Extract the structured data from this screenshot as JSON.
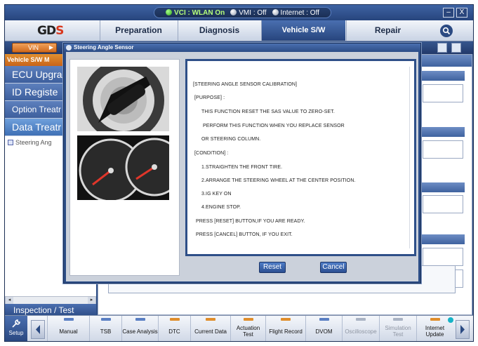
{
  "status_bar": {
    "vci_label": "VCI : WLAN On",
    "vmi_label": "VMI : Off",
    "internet_label": "Internet : Off",
    "minimize_label": "‒",
    "close_label": "X"
  },
  "logo": {
    "text": "GD",
    "mark": "S"
  },
  "nav": {
    "tabs": [
      {
        "label": "Preparation"
      },
      {
        "label": "Diagnosis"
      },
      {
        "label": "Vehicle S/W Management"
      },
      {
        "label": "Repair"
      }
    ]
  },
  "sub_bar": {
    "vin_label": "VIN",
    "vin_arrow": "▶"
  },
  "sidebar": {
    "header": "Vehicle S/W M",
    "items": [
      {
        "label": "ECU Upgra"
      },
      {
        "label": "ID Registe"
      },
      {
        "label": "Option Treatr"
      },
      {
        "label": "Data Treatr"
      }
    ],
    "tree_item": "Steering Ang",
    "inspection_tab": "Inspection / Test"
  },
  "dialog": {
    "title": "Steering Angle Sensor",
    "lines": [
      "[STEERING ANGLE SENSOR CALIBRATION]",
      "[PURPOSE] :",
      "THIS FUNCTION RESET THE SAS VALUE TO ZERO-SET.",
      "PERFORM THIS FUNCTION WHEN YOU REPLACE SENSOR",
      "OR STEERING COLUMN.",
      "[CONDITION] :",
      "1.STRAIGHTEN THE FRONT TIRE.",
      "2.ARRANGE THE STEERING WHEEL AT THE CENTER POSITION.",
      "3.IG KEY ON",
      "4.ENGINE STOP.",
      "PRESS [RESET] BUTTON,IF YOU ARE READY.",
      "PRESS [CANCEL] BUTTON, IF YOU EXIT."
    ],
    "reset_label": "Reset",
    "cancel_label": "Cancel"
  },
  "bottom_bar": {
    "setup_label": "Setup",
    "tools": [
      {
        "label": "Manual",
        "icon": "manual-icon"
      },
      {
        "label": "TSB",
        "icon": "tsb-icon"
      },
      {
        "label": "Case Analysis",
        "icon": "case-analysis-icon"
      },
      {
        "label": "DTC",
        "icon": "dtc-icon"
      },
      {
        "label": "Current Data",
        "icon": "current-data-icon"
      },
      {
        "label": "Actuation Test",
        "icon": "actuation-test-icon"
      },
      {
        "label": "Flight Record",
        "icon": "flight-record-icon"
      },
      {
        "label": "DVOM",
        "icon": "dvom-icon"
      },
      {
        "label": "Oscilloscope",
        "icon": "oscilloscope-icon"
      },
      {
        "label": "Simulation Test",
        "icon": "simulation-test-icon"
      },
      {
        "label": "Internet Update",
        "icon": "internet-update-icon"
      }
    ]
  },
  "colors": {
    "accent": "#2f4f86",
    "active_tab": "#27457d",
    "vin_button": "#d16a1c",
    "sidebar_header": "#c8641a"
  }
}
